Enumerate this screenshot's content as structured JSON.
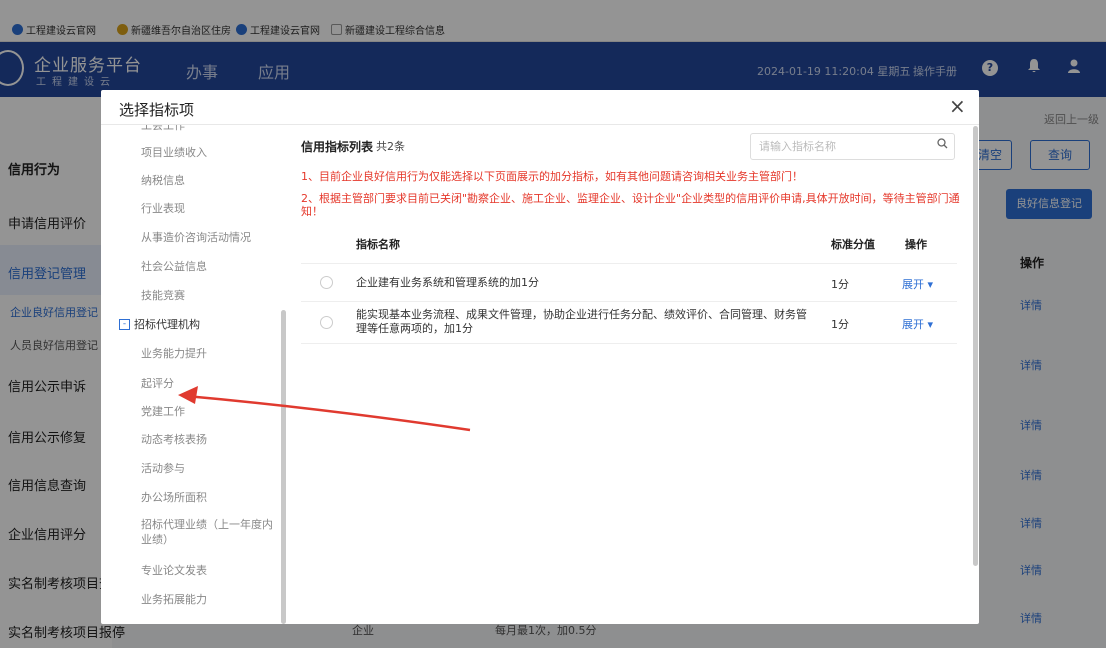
{
  "bookmarks": [
    {
      "label": "工程建设云官网",
      "icon": "cloud-icon",
      "color": "#2e6fd4"
    },
    {
      "label": "新疆维吾尔自治区住房",
      "icon": "emblem-icon",
      "color": "#d9a21a"
    },
    {
      "label": "工程建设云官网",
      "icon": "cloud-icon",
      "color": "#2e6fd4"
    },
    {
      "label": "新疆建设工程综合信息",
      "icon": "page-icon",
      "color": "#999999"
    }
  ],
  "header": {
    "logo_title": "企业服务平台",
    "logo_sub": "工程建设云",
    "nav": [
      "办事",
      "应用"
    ],
    "datetime": "2024-01-19 11:20:04 星期五",
    "manual": "操作手册",
    "icons": [
      "help-icon",
      "bell-icon",
      "user-icon"
    ],
    "bg_color": "#23489b"
  },
  "background": {
    "crumb": "",
    "back": "返回上一级",
    "menu": [
      "信用行为",
      "申请信用评价",
      "信用登记管理",
      "信用公示申诉",
      "信用公示修复",
      "信用信息查询",
      "企业信用评分",
      "实名制考核项目查",
      "实名制考核项目报停"
    ],
    "submenu": [
      "企业良好信用登记",
      "人员良好信用登记"
    ],
    "buttons": {
      "clear": "清空",
      "query": "查询",
      "good": "良好信息登记"
    },
    "op_header": "操作",
    "detail": "详情",
    "row_fragment": [
      "企业",
      "每月最1次，加0.5分"
    ]
  },
  "modal": {
    "title": "选择指标项",
    "close": "×",
    "tree": {
      "items_before": [
        "工会工作",
        "项目业绩收入",
        "纳税信息",
        "行业表现",
        "从事造价咨询活动情况",
        "社会公益信息",
        "技能竞赛"
      ],
      "parent": {
        "toggle": "-",
        "label": "招标代理机构"
      },
      "items_after": [
        "业务能力提升",
        "起评分",
        "党建工作",
        "动态考核表扬",
        "活动参与",
        "办公场所面积",
        "招标代理业绩（上一年度内业绩）",
        "专业论文发表",
        "业务拓展能力"
      ]
    },
    "list": {
      "title": "信用指标列表",
      "count": "共2条",
      "search_placeholder": "请输入指标名称",
      "notices": [
        "1、目前企业良好信用行为仅能选择以下页面展示的加分指标，如有其他问题请咨询相关业务主管部门！",
        "2、根据主管部门要求目前已关闭\"勘察企业、施工企业、监理企业、设计企业\"企业类型的信用评价申请,具体开放时间，等待主管部门通知！"
      ],
      "columns": {
        "name": "指标名称",
        "score": "标准分值",
        "op": "操作"
      },
      "rows": [
        {
          "name": "企业建有业务系统和管理系统的加1分",
          "score": "1分",
          "op": "展开 ▾"
        },
        {
          "name": "能实现基本业务流程、成果文件管理，协助企业进行任务分配、绩效评价、合同管理、财务管理等任意两项的，加1分",
          "score": "1分",
          "op": "展开 ▾"
        }
      ]
    }
  },
  "colors": {
    "accent": "#2e6fd4",
    "warning": "#e5372a",
    "arrow": "#e03a2f"
  }
}
